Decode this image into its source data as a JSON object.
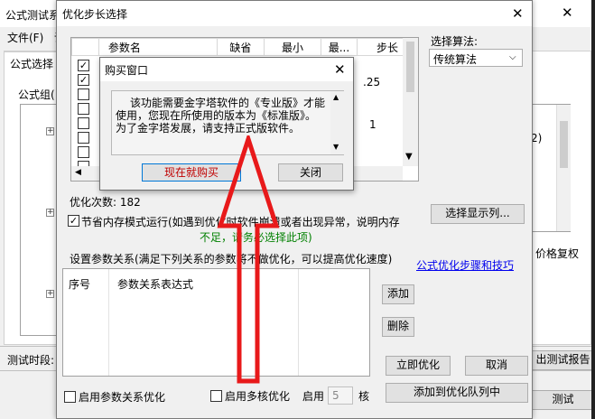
{
  "back_window": {
    "title": "公式测试系",
    "menu_file": "文件(F)",
    "menu_second": "说",
    "tab": "公式选择",
    "group_label": "公式组(",
    "right_fragment_2": "2)",
    "price_text": "价格复权",
    "report_btn": "出测试报告",
    "test_btn": "测试",
    "period_label": "测试时段:"
  },
  "opt_dialog": {
    "title": "优化步长选择",
    "close": "✕",
    "table": {
      "columns": [
        "参数名",
        "缺省",
        "最小",
        "最...",
        "步长"
      ],
      "visible_cell": ".25",
      "visible_cell2": "1",
      "row_checks": [
        true,
        true,
        false,
        false,
        false,
        false,
        false,
        false
      ]
    },
    "algo_label": "选择算法:",
    "algo_value": "传统算法",
    "opt_count": "优化次数: 182",
    "display_btn": "选择显示列...",
    "mem_mode_text": "节省内存模式运行(如遇到优化时软件崩溃或者出现异常，说明内存",
    "mem_mode_warn": "不足，请务必选择此项)",
    "param_rel_label": "设置参数关系(满足下列关系的参数将不做优化，可以提高优化速度)",
    "steps_link": "公式优化步骤和技巧",
    "rel_table_cols": [
      "序号",
      "参数关系表达式"
    ],
    "add_btn": "添加",
    "del_btn": "删除",
    "run_btn": "立即优化",
    "cancel_btn": "取消",
    "queue_btn": "添加到优化队列中",
    "enable_rel": "启用参数关系优化",
    "enable_multi": "启用多核优化",
    "enable_label": "启用",
    "core_value": "5",
    "core_unit": "核"
  },
  "buy_dialog": {
    "title": "购买窗口",
    "close": "✕",
    "message_line1": "该功能需要金字塔软件的《专业版》才能",
    "message_line2": "使用，您现在所使用的版本为《标准版》。",
    "message_line3": "为了金字塔发展，请支持正式版软件。",
    "buy_btn": "现在就购买",
    "close_btn": "关闭"
  },
  "colors": {
    "accent_link": "#0000ee",
    "warn_green": "#008000",
    "arrow_red": "#e8191a",
    "buy_text": "#c00000"
  }
}
